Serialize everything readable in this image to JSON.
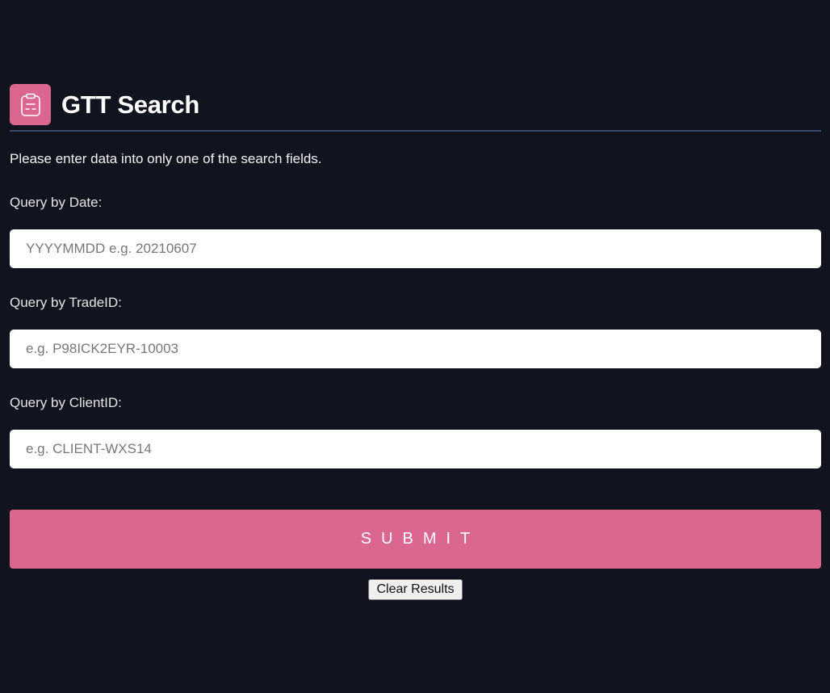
{
  "header": {
    "title": "GTT Search",
    "logo_icon": "clipboard-icon",
    "logo_color": "#db668f"
  },
  "instructions": "Please enter data into only one of the search fields.",
  "fields": {
    "date": {
      "label": "Query by Date:",
      "placeholder": "YYYYMMDD e.g. 20210607",
      "value": ""
    },
    "trade_id": {
      "label": "Query by TradeID:",
      "placeholder": "e.g. P98ICK2EYR-10003",
      "value": ""
    },
    "client_id": {
      "label": "Query by ClientID:",
      "placeholder": "e.g. CLIENT-WXS14",
      "value": ""
    }
  },
  "actions": {
    "submit_label": "SUBMIT",
    "clear_label": "Clear Results"
  },
  "colors": {
    "background": "#11131f",
    "accent": "#db668f",
    "divider": "#3d4a6a"
  }
}
